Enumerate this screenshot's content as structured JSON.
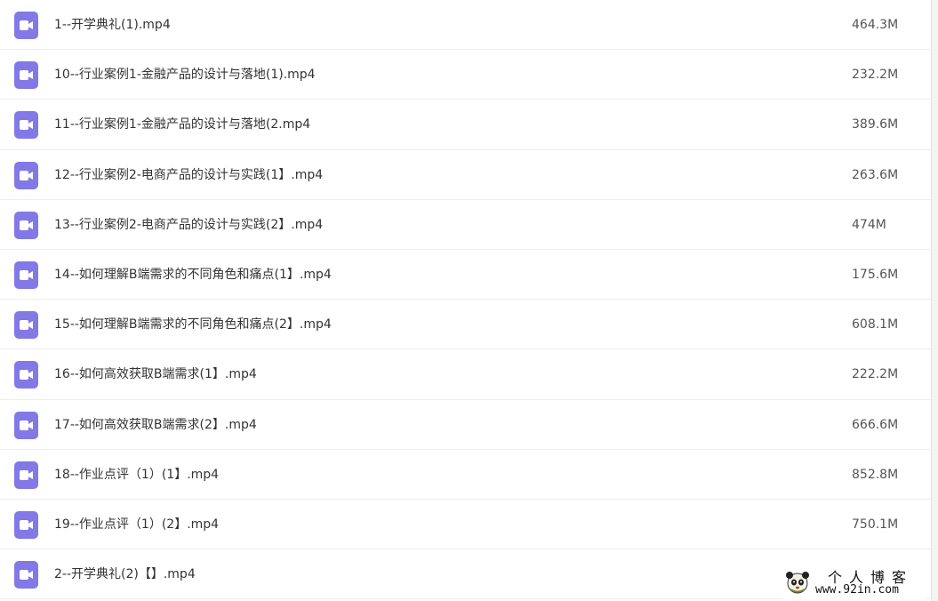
{
  "files": [
    {
      "name": "1--开学典礼(1).mp4",
      "size": "464.3M",
      "icon": "video-file-icon"
    },
    {
      "name": "10--行业案例1-金融产品的设计与落地(1).mp4",
      "size": "232.2M",
      "icon": "video-file-icon"
    },
    {
      "name": "11--行业案例1-金融产品的设计与落地(2.mp4",
      "size": "389.6M",
      "icon": "video-file-icon"
    },
    {
      "name": "12--行业案例2-电商产品的设计与实践(1】.mp4",
      "size": "263.6M",
      "icon": "video-file-icon"
    },
    {
      "name": "13--行业案例2-电商产品的设计与实践(2】.mp4",
      "size": "474M",
      "icon": "video-file-icon"
    },
    {
      "name": "14--如何理解B端需求的不同角色和痛点(1】.mp4",
      "size": "175.6M",
      "icon": "video-file-icon"
    },
    {
      "name": "15--如何理解B端需求的不同角色和痛点(2】.mp4",
      "size": "608.1M",
      "icon": "video-file-icon"
    },
    {
      "name": "16--如何高效获取B端需求(1】.mp4",
      "size": "222.2M",
      "icon": "video-file-icon"
    },
    {
      "name": "17--如何高效获取B端需求(2】.mp4",
      "size": "666.6M",
      "icon": "video-file-icon"
    },
    {
      "name": "18--作业点评（1）(1】.mp4",
      "size": "852.8M",
      "icon": "video-file-icon"
    },
    {
      "name": "19--作业点评（1）(2】.mp4",
      "size": "750.1M",
      "icon": "video-file-icon"
    },
    {
      "name": "2--开学典礼(2)【】.mp4",
      "size": "",
      "icon": "video-file-icon"
    }
  ],
  "watermark": {
    "title": "个人博客",
    "url": "www.92in.com"
  },
  "colors": {
    "icon": "#8279e6",
    "text": "#333333",
    "divider": "#eeeeee"
  }
}
